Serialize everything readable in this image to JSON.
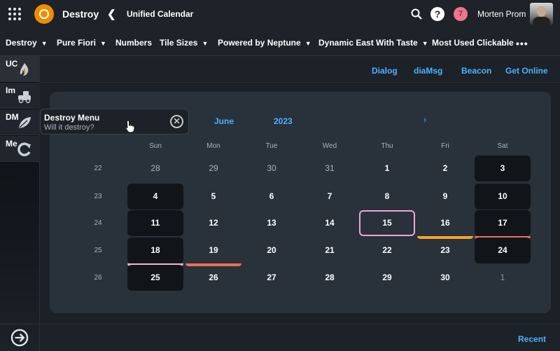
{
  "shell": {
    "app_title": "Destroy",
    "page_title": "Unified Calendar",
    "notification_count": "7",
    "user_name": "Morten Prom"
  },
  "menu": {
    "items": [
      {
        "label": "Destroy",
        "chevron": true
      },
      {
        "label": "Pure Fiori",
        "chevron": true
      },
      {
        "label": "Numbers",
        "chevron": false
      },
      {
        "label": "Tile Sizes",
        "chevron": true
      },
      {
        "label": "Powered by Neptune",
        "chevron": true
      },
      {
        "label": "Dynamic East With Taste",
        "chevron": true
      },
      {
        "label": "Most Used Clickable",
        "chevron": false
      }
    ],
    "more": "•••"
  },
  "rail": {
    "items": [
      {
        "label": "UC",
        "icon": "flame-icon"
      },
      {
        "label": "Im",
        "icon": "truck-icon"
      },
      {
        "label": "DM",
        "icon": "leaf-icon"
      },
      {
        "label": "Me",
        "icon": "refresh-icon"
      }
    ]
  },
  "toolbar": {
    "links": [
      "Dialog",
      "diaMsg",
      "Beacon",
      "Get Online"
    ]
  },
  "popover": {
    "title": "Destroy Menu",
    "subtitle": "Will it destroy?"
  },
  "calendar": {
    "month": "June",
    "year": "2023",
    "next": "›",
    "weekdays": [
      "Sun",
      "Mon",
      "Tue",
      "Wed",
      "Thu",
      "Fri",
      "Sat"
    ],
    "weeks": [
      {
        "num": "22",
        "days": [
          {
            "d": "28",
            "k": "dim"
          },
          {
            "d": "29",
            "k": "dim"
          },
          {
            "d": "30",
            "k": "dim"
          },
          {
            "d": "31",
            "k": "dim"
          },
          {
            "d": "1",
            "k": "norm"
          },
          {
            "d": "2",
            "k": "norm"
          },
          {
            "d": "3",
            "k": "dark"
          }
        ]
      },
      {
        "num": "23",
        "days": [
          {
            "d": "4",
            "k": "dark"
          },
          {
            "d": "5",
            "k": "norm"
          },
          {
            "d": "6",
            "k": "norm"
          },
          {
            "d": "7",
            "k": "norm"
          },
          {
            "d": "8",
            "k": "norm"
          },
          {
            "d": "9",
            "k": "norm"
          },
          {
            "d": "10",
            "k": "dark"
          }
        ]
      },
      {
        "num": "24",
        "days": [
          {
            "d": "11",
            "k": "dark"
          },
          {
            "d": "12",
            "k": "norm"
          },
          {
            "d": "13",
            "k": "norm"
          },
          {
            "d": "14",
            "k": "norm"
          },
          {
            "d": "15",
            "k": "today"
          },
          {
            "d": "16",
            "k": "norm",
            "ind": "#f5a623"
          },
          {
            "d": "17",
            "k": "dark",
            "ind": "#e8705a"
          }
        ]
      },
      {
        "num": "25",
        "days": [
          {
            "d": "18",
            "k": "dark",
            "ind": "#f5b8cc"
          },
          {
            "d": "19",
            "k": "norm",
            "ind": "#e8705a"
          },
          {
            "d": "20",
            "k": "norm"
          },
          {
            "d": "21",
            "k": "norm"
          },
          {
            "d": "22",
            "k": "norm"
          },
          {
            "d": "23",
            "k": "norm"
          },
          {
            "d": "24",
            "k": "dark"
          }
        ]
      },
      {
        "num": "26",
        "days": [
          {
            "d": "25",
            "k": "dark"
          },
          {
            "d": "26",
            "k": "norm"
          },
          {
            "d": "27",
            "k": "norm"
          },
          {
            "d": "28",
            "k": "norm"
          },
          {
            "d": "29",
            "k": "norm"
          },
          {
            "d": "30",
            "k": "norm"
          },
          {
            "d": "1",
            "k": "other"
          }
        ]
      }
    ]
  },
  "footer": {
    "recent": "Recent"
  }
}
